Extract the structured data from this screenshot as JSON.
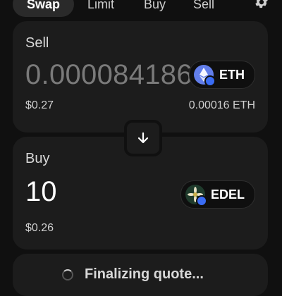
{
  "tabs": {
    "swap": "Swap",
    "limit": "Limit",
    "buy": "Buy",
    "sell": "Sell",
    "settings_icon": "gear-icon"
  },
  "sell_panel": {
    "label": "Sell",
    "amount": "0.000084186",
    "usd_value": "$0.27",
    "token_symbol": "ETH",
    "token_qty": "0.00016 ETH",
    "token_color": "#627eea"
  },
  "switch": {
    "icon": "arrow-down-icon"
  },
  "buy_panel": {
    "label": "Buy",
    "amount": "10",
    "usd_value": "$0.26",
    "token_symbol": "EDEL"
  },
  "quote": {
    "status": "Finalizing quote..."
  },
  "colors": {
    "background": "#101010",
    "card": "#1c1c1c",
    "muted_amount": "#7a7a7a"
  }
}
